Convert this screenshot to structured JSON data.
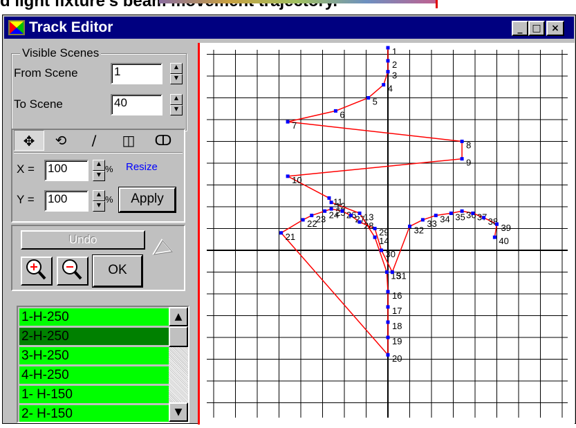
{
  "page_caption": "d light fixture's beam movement trajectory.",
  "window": {
    "title": "Track Editor",
    "controls": {
      "minimize": "_",
      "maximize": "□",
      "close": "×"
    }
  },
  "visible_scenes": {
    "legend": "Visible Scenes",
    "from_label": "From Scene",
    "from_value": "1",
    "to_label": "To Scene",
    "to_value": "40"
  },
  "tools": {
    "icons": [
      "move-icon",
      "rotate-icon",
      "line-icon",
      "shape-icon",
      "circles-icon"
    ],
    "glyphs": [
      "✥",
      "⟲",
      "∕",
      "◫",
      "ↀ"
    ],
    "x_label": "X =",
    "x_value": "100",
    "y_label": "Y =",
    "y_value": "100",
    "percent": "%",
    "resize_label": "Resize",
    "resize_color": "#0000ff",
    "apply_label": "Apply"
  },
  "actions": {
    "undo_label": "Undo",
    "ok_label": "OK",
    "zoom_in": "zoom-in-icon",
    "zoom_out": "zoom-out-icon"
  },
  "list": {
    "items": [
      "1-H-250",
      "2-H-250",
      "3-H-250",
      "4-H-250",
      "1- H-150",
      "2- H-150"
    ],
    "selected_index": 1,
    "item_color": "#00ff00",
    "selected_color": "#008000"
  },
  "track": {
    "line_color": "#ff0000",
    "point_color": "#0000ff",
    "points": [
      {
        "n": "1",
        "x": 0,
        "y": 9.3
      },
      {
        "n": "2",
        "x": 0,
        "y": 8.7
      },
      {
        "n": "3",
        "x": 0,
        "y": 8.2
      },
      {
        "n": "4",
        "x": -0.2,
        "y": 7.6
      },
      {
        "n": "5",
        "x": -0.9,
        "y": 7.0
      },
      {
        "n": "6",
        "x": -2.4,
        "y": 6.4
      },
      {
        "n": "7",
        "x": -4.6,
        "y": 5.9
      },
      {
        "n": "8",
        "x": 3.4,
        "y": 5.0
      },
      {
        "n": "9",
        "x": 3.4,
        "y": 4.2
      },
      {
        "n": "10",
        "x": -4.6,
        "y": 3.4
      },
      {
        "n": "11",
        "x": -2.7,
        "y": 2.4
      },
      {
        "n": "12",
        "x": -2.6,
        "y": 2.2
      },
      {
        "n": "13",
        "x": -1.3,
        "y": 1.7
      },
      {
        "n": "14",
        "x": -0.6,
        "y": 0.6
      },
      {
        "n": "15",
        "x": -0.05,
        "y": -1.0
      },
      {
        "n": "16",
        "x": 0,
        "y": -1.9
      },
      {
        "n": "17",
        "x": 0,
        "y": -2.6
      },
      {
        "n": "18",
        "x": 0,
        "y": -3.3
      },
      {
        "n": "19",
        "x": 0,
        "y": -4.0
      },
      {
        "n": "20",
        "x": 0,
        "y": -4.8
      },
      {
        "n": "21",
        "x": -4.9,
        "y": 0.8
      },
      {
        "n": "22",
        "x": -3.9,
        "y": 1.4
      },
      {
        "n": "23",
        "x": -3.5,
        "y": 1.6
      },
      {
        "n": "24",
        "x": -2.9,
        "y": 1.8
      },
      {
        "n": "25",
        "x": -2.6,
        "y": 1.9
      },
      {
        "n": "26",
        "x": -2.1,
        "y": 1.8
      },
      {
        "n": "27",
        "x": -1.7,
        "y": 1.6
      },
      {
        "n": "28",
        "x": -1.3,
        "y": 1.3
      },
      {
        "n": "29",
        "x": -0.6,
        "y": 1.0
      },
      {
        "n": "30",
        "x": -0.3,
        "y": 0.0
      },
      {
        "n": "31",
        "x": 0.2,
        "y": -1.0
      },
      {
        "n": "32",
        "x": 1.0,
        "y": 1.1
      },
      {
        "n": "33",
        "x": 1.6,
        "y": 1.4
      },
      {
        "n": "34",
        "x": 2.2,
        "y": 1.6
      },
      {
        "n": "35",
        "x": 2.9,
        "y": 1.7
      },
      {
        "n": "36",
        "x": 3.4,
        "y": 1.8
      },
      {
        "n": "37",
        "x": 3.9,
        "y": 1.7
      },
      {
        "n": "38",
        "x": 4.4,
        "y": 1.5
      },
      {
        "n": "39",
        "x": 5.0,
        "y": 1.2
      },
      {
        "n": "40",
        "x": 4.9,
        "y": 0.6
      }
    ],
    "path_order": [
      "1",
      "2",
      "3",
      "4",
      "5",
      "6",
      "7",
      "8",
      "9",
      "10",
      "11",
      "12",
      "13",
      "14",
      "15",
      "16",
      "17",
      "18",
      "19",
      "20",
      "21",
      "22",
      "23",
      "24",
      "25",
      "26",
      "27",
      "28",
      "29",
      "30",
      "31",
      "32",
      "33",
      "34",
      "35",
      "36",
      "37",
      "38",
      "39",
      "40"
    ],
    "segments": [
      [
        0,
        9
      ],
      [
        9,
        19
      ],
      [
        19,
        20
      ],
      [
        20,
        39
      ]
    ]
  }
}
